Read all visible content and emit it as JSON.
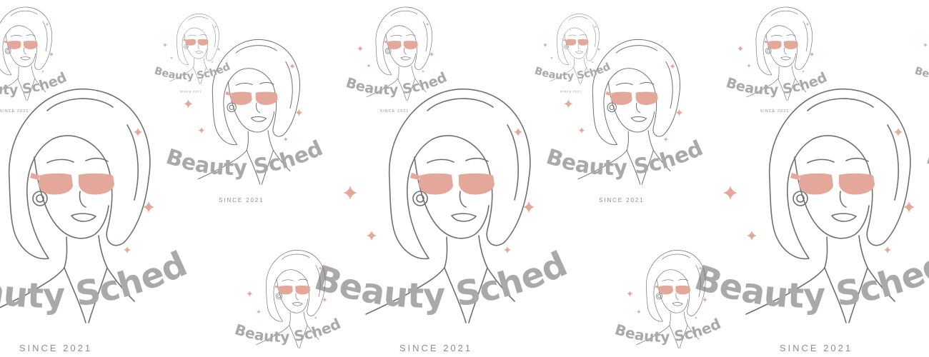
{
  "brand": {
    "name": "Beauty Scheduler",
    "tagline": "SINCE 2021"
  },
  "colors": {
    "background": "#ffffff",
    "wordmark": "#a9a9a9",
    "tagline": "#8f8f8f",
    "glasses": "#e3a89a",
    "sparkle": "#e3a89a",
    "lineart": "#6f6f6f"
  },
  "icons": [
    "woman-with-sunglasses-icon",
    "sparkle-icon"
  ],
  "pattern": {
    "type": "repeating-logo-watermark"
  }
}
